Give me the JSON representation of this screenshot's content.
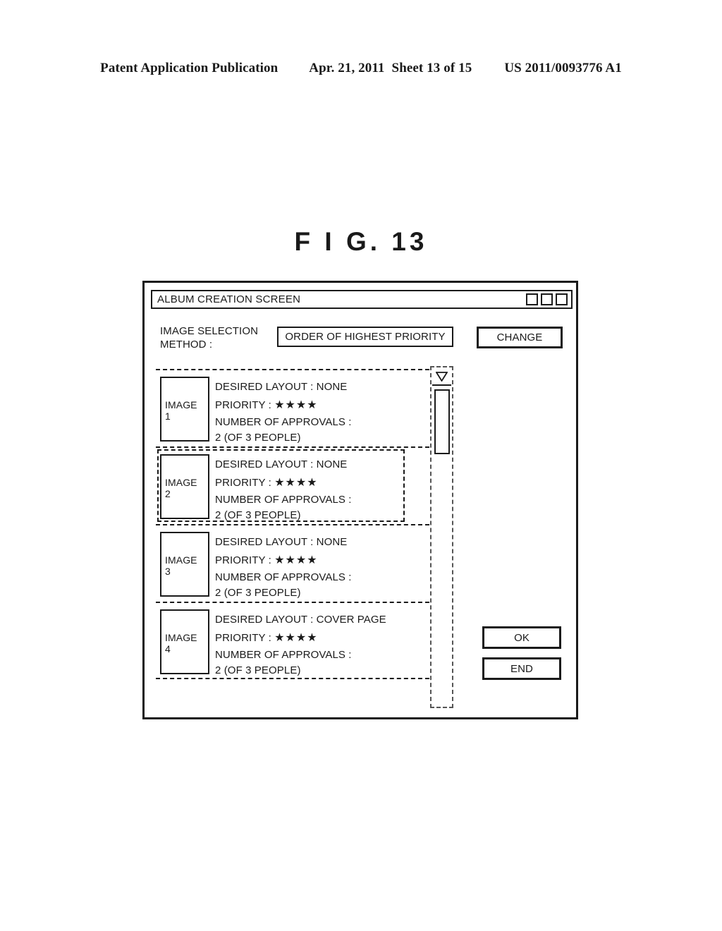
{
  "patent_header": {
    "publication": "Patent Application Publication",
    "date": "Apr. 21, 2011",
    "sheet": "Sheet 13 of 15",
    "number": "US 2011/0093776 A1"
  },
  "figure": {
    "caption": "F I G.  13"
  },
  "window": {
    "title": "ALBUM CREATION SCREEN",
    "controls": [
      "minimize-box",
      "maximize-box",
      "close-box"
    ]
  },
  "method": {
    "label": "IMAGE SELECTION\nMETHOD :",
    "value": "ORDER OF HIGHEST PRIORITY",
    "change_label": "CHANGE"
  },
  "list": {
    "labels": {
      "desired_layout": "DESIRED LAYOUT :",
      "priority": "PRIORITY :",
      "approvals": "NUMBER OF APPROVALS :"
    },
    "rows": [
      {
        "thumb_label": "IMAGE",
        "thumb_number": "1",
        "desired_layout_line": "DESIRED LAYOUT : NONE",
        "priority_label": "PRIORITY :",
        "priority_stars": "★★★★",
        "priority_value": 4,
        "approvals_label": "NUMBER OF APPROVALS :",
        "approvals_value": "2 (OF 3 PEOPLE)",
        "selected": false
      },
      {
        "thumb_label": "IMAGE",
        "thumb_number": "2",
        "desired_layout_line": "DESIRED LAYOUT : NONE",
        "priority_label": "PRIORITY :",
        "priority_stars": "★★★★",
        "priority_value": 4,
        "approvals_label": "NUMBER OF APPROVALS :",
        "approvals_value": "2 (OF 3 PEOPLE)",
        "selected": true
      },
      {
        "thumb_label": "IMAGE",
        "thumb_number": "3",
        "desired_layout_line": "DESIRED LAYOUT : NONE",
        "priority_label": "PRIORITY :",
        "priority_stars": "★★★★",
        "priority_value": 4,
        "approvals_label": "NUMBER OF APPROVALS :",
        "approvals_value": "2 (OF 3 PEOPLE)",
        "selected": false
      },
      {
        "thumb_label": "IMAGE",
        "thumb_number": "4",
        "desired_layout_line": "DESIRED LAYOUT : COVER PAGE",
        "priority_label": "PRIORITY :",
        "priority_stars": "★★★★",
        "priority_value": 4,
        "approvals_label": "NUMBER OF APPROVALS :",
        "approvals_value": "2 (OF 3 PEOPLE)",
        "selected": false
      }
    ]
  },
  "scrollbar": {
    "arrow_icon": "triangle-down-icon"
  },
  "actions": {
    "ok_label": "OK",
    "end_label": "END"
  },
  "colors": {
    "ink": "#1a1a1a",
    "paper": "#ffffff"
  }
}
